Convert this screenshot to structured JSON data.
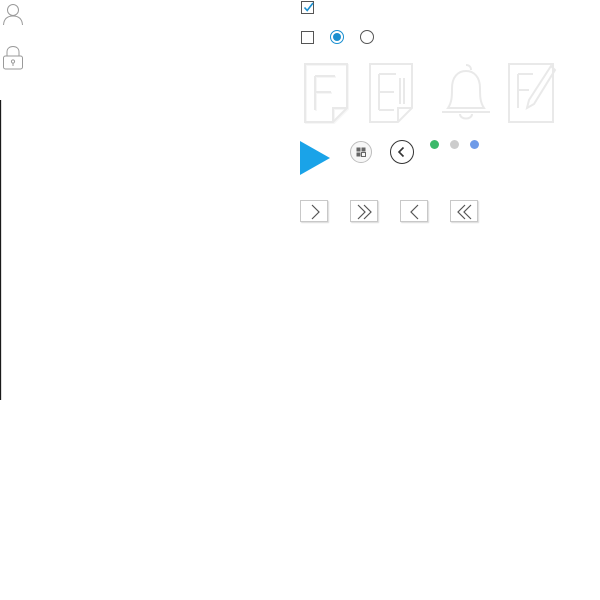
{
  "colors": {
    "accent_blue": "#1a8fd0",
    "play_blue": "#1aa3e8",
    "status_green": "#3cb96a",
    "status_gray": "#cccccc",
    "status_blue": "#6f9be8",
    "icon_gray": "#999999",
    "ghost_stroke": "#eeeeee"
  },
  "left_column": {
    "icons": [
      "user-icon",
      "lock-icon"
    ]
  },
  "controls": {
    "checkbox_checked": true,
    "checkbox_unchecked": false,
    "radio_selected": true,
    "radio_unselected": false
  },
  "ghost_icons": [
    "document-icon",
    "document-lines-icon",
    "bell-icon",
    "edit-document-icon"
  ],
  "media_row": {
    "icons": [
      "play-icon",
      "grid-icon",
      "back-circle-icon"
    ],
    "status_dots": [
      "green",
      "gray",
      "blue"
    ]
  },
  "pager": {
    "buttons": [
      "next-button",
      "last-button",
      "prev-button",
      "first-button"
    ]
  }
}
